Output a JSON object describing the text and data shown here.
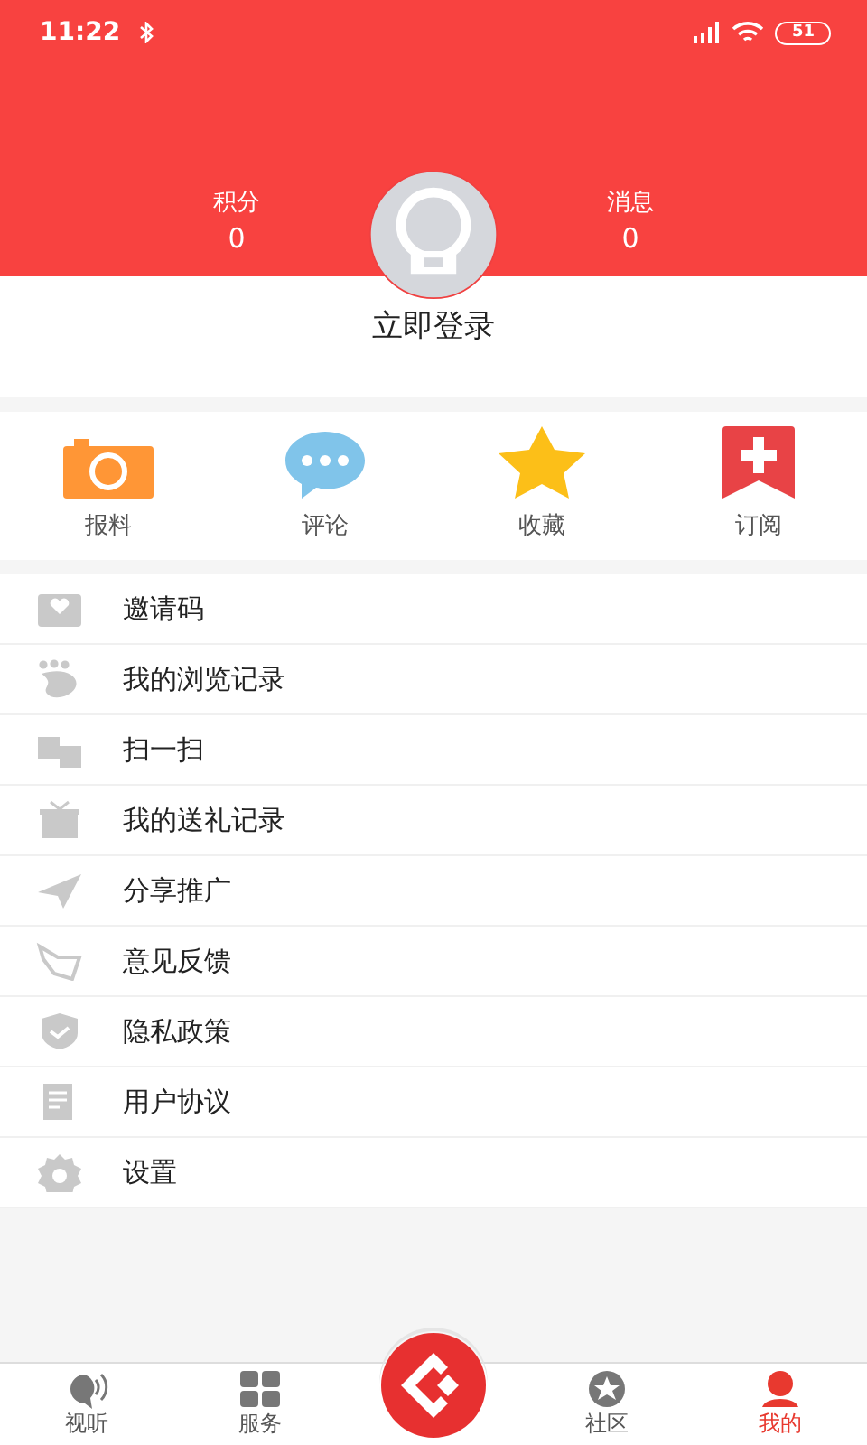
{
  "status_bar": {
    "time": "11:22",
    "battery": "51"
  },
  "profile": {
    "stats": [
      {
        "label": "积分",
        "value": "0"
      },
      {
        "label": "消息",
        "value": "0"
      }
    ],
    "login": "立即登录"
  },
  "quick_actions": [
    {
      "label": "报料"
    },
    {
      "label": "评论"
    },
    {
      "label": "收藏"
    },
    {
      "label": "订阅"
    }
  ],
  "menu": [
    {
      "label": "邀请码"
    },
    {
      "label": "我的浏览记录"
    },
    {
      "label": "扫一扫"
    },
    {
      "label": "我的送礼记录"
    },
    {
      "label": "分享推广"
    },
    {
      "label": "意见反馈"
    },
    {
      "label": "隐私政策"
    },
    {
      "label": "用户协议"
    },
    {
      "label": "设置"
    }
  ],
  "bottom_nav": [
    {
      "kind": "tab",
      "label": "视听",
      "selected": false
    },
    {
      "kind": "tab",
      "label": "服务",
      "selected": false
    },
    {
      "kind": "logo",
      "selected": false
    },
    {
      "kind": "tab",
      "label": "社区",
      "selected": false
    },
    {
      "kind": "tab",
      "label": "我的",
      "selected": true
    }
  ]
}
